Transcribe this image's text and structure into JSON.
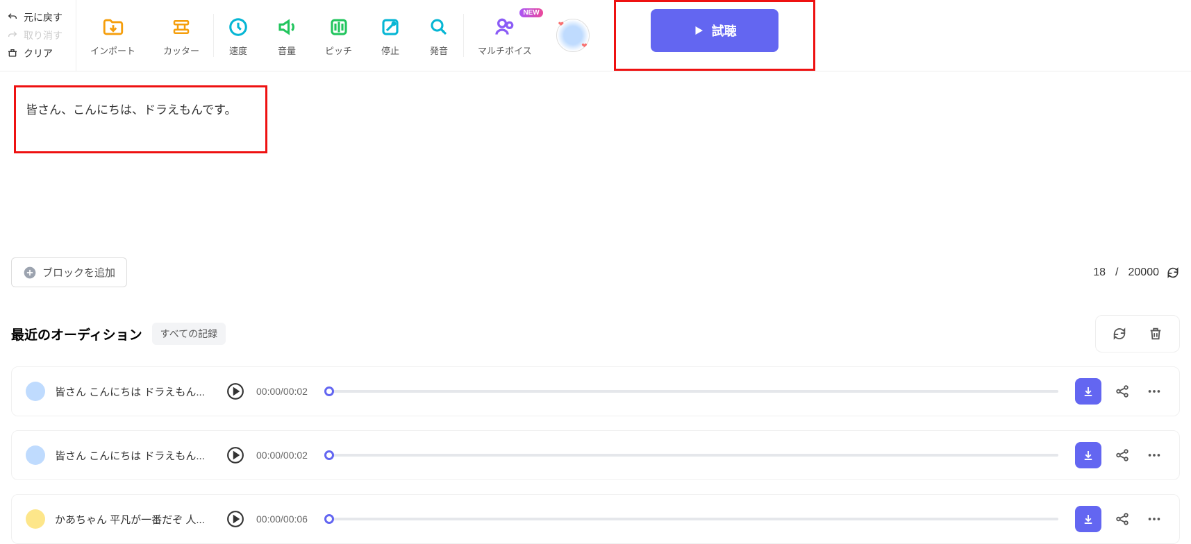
{
  "toolbar": {
    "undo": "元に戻す",
    "redo": "取り消す",
    "clear": "クリア",
    "import": "インポート",
    "cutter": "カッター",
    "speed": "速度",
    "volume": "音量",
    "pitch": "ピッチ",
    "stop": "停止",
    "pronunciation": "発音",
    "multivoice": "マルチボイス",
    "new_badge": "NEW",
    "listen": "試聴"
  },
  "editor": {
    "text": "皆さん、こんにちは、ドラえもんです。",
    "add_block": "ブロックを追加",
    "char_count": "18",
    "char_limit": "20000"
  },
  "recent": {
    "heading": "最近のオーディション",
    "all_records": "すべての記録",
    "rows": [
      {
        "title": "皆さん こんにちは ドラえもん...",
        "time": "00:00/00:02"
      },
      {
        "title": "皆さん こんにちは ドラえもん...",
        "time": "00:00/00:02"
      },
      {
        "title": "かあちゃん 平凡が一番だぞ 人...",
        "time": "00:00/00:06"
      }
    ]
  }
}
